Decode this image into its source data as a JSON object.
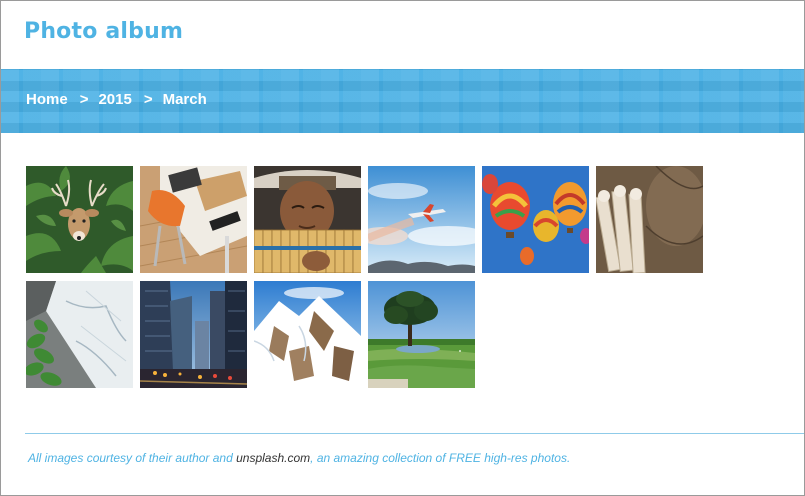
{
  "header": {
    "title": "Photo album"
  },
  "breadcrumb": {
    "items": [
      {
        "label": "Home"
      },
      {
        "label": "2015"
      },
      {
        "label": "March"
      }
    ],
    "separator": ">"
  },
  "gallery": {
    "photos": [
      {
        "icon": "deer-photo"
      },
      {
        "icon": "desk-chair-photo"
      },
      {
        "icon": "pan-flute-player-photo"
      },
      {
        "icon": "airplane-photo"
      },
      {
        "icon": "hot-air-balloons-photo"
      },
      {
        "icon": "scrolls-map-photo"
      },
      {
        "icon": "map-plant-photo"
      },
      {
        "icon": "city-street-photo"
      },
      {
        "icon": "snowy-mountain-photo"
      },
      {
        "icon": "tree-field-photo"
      }
    ]
  },
  "footer": {
    "text_before": "All images courtesy of their author and ",
    "link": "unsplash.com",
    "text_after": ", an amazing collection of FREE high-res photos."
  },
  "colors": {
    "accent": "#4fb3e3",
    "banner": "#45aee4",
    "link": "#333333"
  }
}
